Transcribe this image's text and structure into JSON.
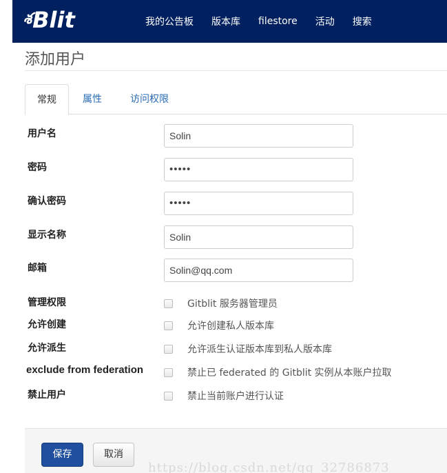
{
  "brand": {
    "mark": "శ",
    "name": "Blit"
  },
  "nav": {
    "items": [
      "我的公告板",
      "版本库",
      "filestore",
      "活动",
      "搜索"
    ]
  },
  "page": {
    "title": "添加用户"
  },
  "tabs": [
    "常规",
    "属性",
    "访问权限"
  ],
  "form": {
    "username": {
      "label": "用户名",
      "value": "Solin"
    },
    "password": {
      "label": "密码",
      "value": "•••••"
    },
    "confirm_password": {
      "label": "确认密码",
      "value": "•••••"
    },
    "display_name": {
      "label": "显示名称",
      "value": "Solin"
    },
    "email": {
      "label": "邮箱",
      "value": "Solin@qq.com"
    },
    "admin": {
      "label": "管理权限",
      "text": "Gitblit 服务器管理员",
      "checked": false
    },
    "can_create": {
      "label": "允许创建",
      "text": "允许创建私人版本库",
      "checked": false
    },
    "can_fork": {
      "label": "允许派生",
      "text": "允许派生认证版本库到私人版本库",
      "checked": false
    },
    "exclude_federation": {
      "label": "exclude from federation",
      "text": "禁止已 federated 的 Gitblit 实例从本账户拉取",
      "checked": false
    },
    "disabled": {
      "label": "禁止用户",
      "text": "禁止当前账户进行认证",
      "checked": false
    }
  },
  "actions": {
    "save": "保存",
    "cancel": "取消"
  },
  "watermark": "https://blog.csdn.net/qq_32786873",
  "colors": {
    "navbar": "#002060",
    "link": "#2a6db5",
    "primary_button": "#1f4f9e"
  }
}
